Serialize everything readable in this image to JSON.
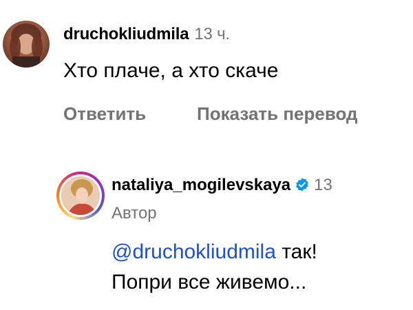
{
  "comments": [
    {
      "username": "druchokliudmila",
      "time": "13 ч.",
      "text": "Хто плаче, а хто скаче",
      "reply_label": "Ответить",
      "translate_label": "Показать перевод"
    }
  ],
  "reply": {
    "username": "nataliya_mogilevskaya",
    "verified_icon": "verified-badge-icon",
    "time": "13",
    "author_label": "Автор",
    "mention": "@druchokliudmila",
    "text_line1_after_mention": " так!",
    "text_line2": "Попри все живемо..."
  },
  "colors": {
    "meta_gray": "#737373",
    "mention_blue": "#1d4fd8",
    "verified_blue": "#0095f6"
  }
}
